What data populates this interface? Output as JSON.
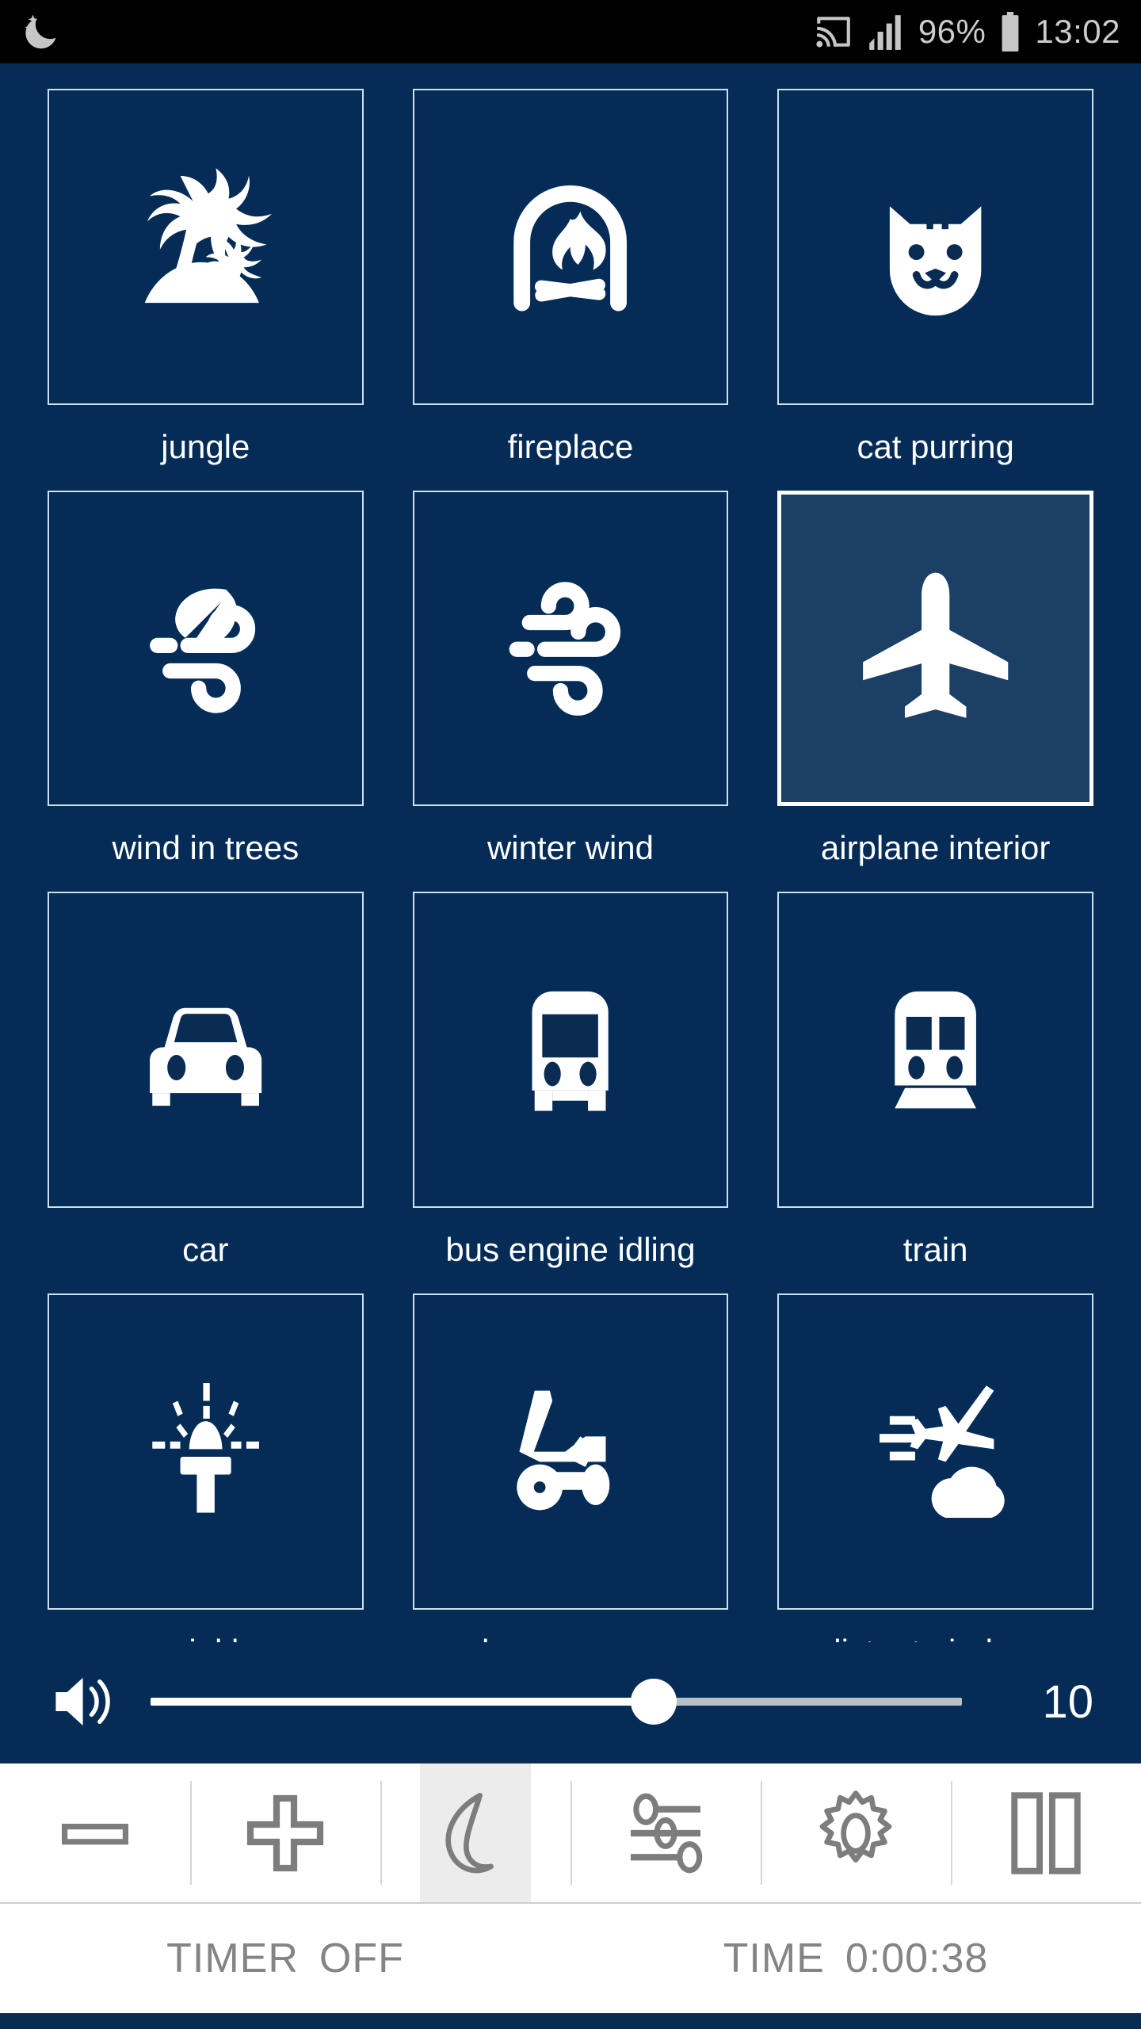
{
  "status_bar": {
    "night_mode_icon": "crescent-moon-icon",
    "cast_icon": "cast-icon",
    "signal_icon": "signal-bars-icon",
    "battery_percent": "96%",
    "battery_icon": "battery-full-icon",
    "time": "13:02"
  },
  "sounds": [
    {
      "label": "jungle",
      "icon": "palm-island-icon",
      "selected": false
    },
    {
      "label": "fireplace",
      "icon": "fireplace-icon",
      "selected": false
    },
    {
      "label": "cat purring",
      "icon": "cat-face-icon",
      "selected": false
    },
    {
      "label": "wind in trees",
      "icon": "wind-leaf-icon",
      "selected": false
    },
    {
      "label": "winter wind",
      "icon": "wind-icon",
      "selected": false
    },
    {
      "label": "airplane interior",
      "icon": "airplane-icon",
      "selected": true
    },
    {
      "label": "car",
      "icon": "car-front-icon",
      "selected": false
    },
    {
      "label": "bus engine idling",
      "icon": "bus-front-icon",
      "selected": false
    },
    {
      "label": "train",
      "icon": "train-front-icon",
      "selected": false
    },
    {
      "label": "sprinkler",
      "icon": "sprinkler-icon",
      "selected": false
    },
    {
      "label": "lawn mower",
      "icon": "lawn-mower-icon",
      "selected": false
    },
    {
      "label": "distant airplane",
      "icon": "distant-plane-icon",
      "selected": false
    }
  ],
  "volume": {
    "icon": "speaker-volume-icon",
    "value": "10",
    "percent": 62
  },
  "toolbar": [
    {
      "name": "minus-button",
      "icon": "minus-icon",
      "active": false
    },
    {
      "name": "plus-button",
      "icon": "plus-icon",
      "active": false
    },
    {
      "name": "night-button",
      "icon": "crescent-moon-icon",
      "active": true
    },
    {
      "name": "mixer-button",
      "icon": "sliders-icon",
      "active": false
    },
    {
      "name": "settings-button",
      "icon": "gear-icon",
      "active": false
    },
    {
      "name": "pause-button",
      "icon": "pause-icon",
      "active": false
    }
  ],
  "timer": {
    "timer_label": "TIMER",
    "timer_value": "OFF",
    "time_label": "TIME",
    "time_value": "0:00:38"
  },
  "colors": {
    "page_background": "#042c57",
    "tile_border": "#cfe0ea",
    "tile_selected_background": "#1c3f66",
    "accent_white": "#ffffff",
    "toolbar_background": "#ffffff",
    "toolbar_icon": "#7d7d7d",
    "timer_text": "#848484"
  }
}
